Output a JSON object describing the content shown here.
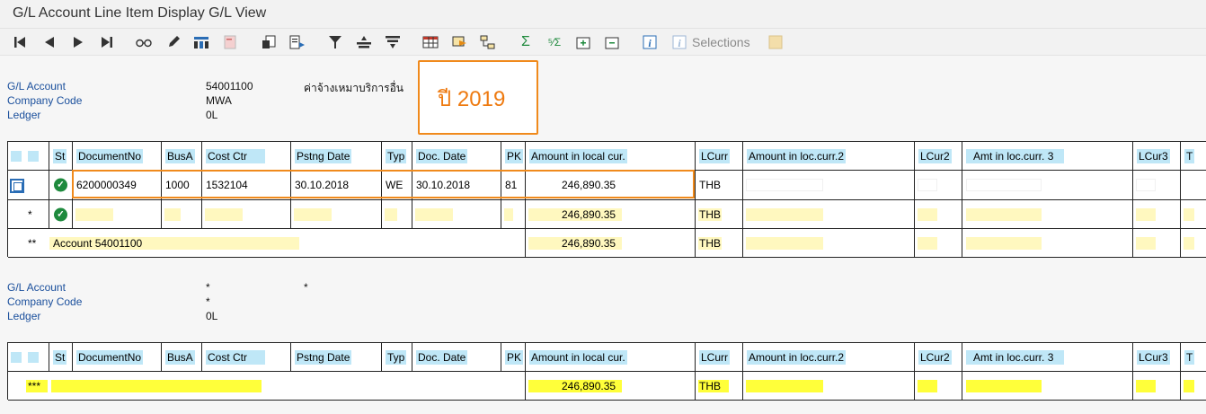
{
  "window": {
    "title": "G/L Account Line Item Display G/L View"
  },
  "toolbar": {
    "icons": [
      "first-page-icon",
      "previous-page-icon",
      "next-page-icon",
      "last-page-icon",
      "glasses-icon",
      "pencil-icon",
      "layout-icon",
      "document-icon",
      "print-list-icon",
      "export-icon",
      "filter-icon",
      "sort-ascending-icon",
      "sort-descending-icon",
      "table-icon",
      "export-spreadsheet-icon",
      "hierarchy-icon",
      "sum-icon",
      "subtotal-icon",
      "expand-icon",
      "collapse-icon",
      "info-icon",
      "info-disabled-icon",
      "note-icon"
    ],
    "selections_label": "Selections"
  },
  "header1": {
    "labels": [
      "G/L Account",
      "Company Code",
      "Ledger"
    ],
    "values": [
      "54001100",
      "MWA",
      "0L"
    ],
    "account_desc": "ค่าจ้างเหมาบริการอื่น"
  },
  "callout": {
    "text": "ปี 2019"
  },
  "columns": [
    "St",
    "DocumentNo",
    "BusA",
    "Cost Ctr",
    "Pstng Date",
    "Typ",
    "Doc. Date",
    "PK",
    "Amount in local cur.",
    "LCurr",
    "Amount in loc.curr.2",
    "LCur2",
    "Amt in loc.curr. 3",
    "LCur3",
    "T"
  ],
  "table1": {
    "row1": {
      "document_no": "6200000349",
      "bus_area": "1000",
      "cost_ctr": "1532104",
      "pstng_date": "30.10.2018",
      "typ": "WE",
      "doc_date": "30.10.2018",
      "pk": "81",
      "amount": "246,890.35",
      "lcurr": "THB"
    },
    "row2": {
      "marker": "*",
      "amount": "246,890.35",
      "lcurr": "THB"
    },
    "row3": {
      "marker": "**",
      "label": "Account 54001100",
      "amount": "246,890.35",
      "lcurr": "THB"
    }
  },
  "header2": {
    "labels": [
      "G/L Account",
      "Company Code",
      "Ledger"
    ],
    "values": [
      "*",
      "*",
      "0L"
    ],
    "account_desc": "*"
  },
  "table2": {
    "total_row": {
      "marker": "***",
      "amount": "246,890.35",
      "lcurr": "THB"
    }
  },
  "colors": {
    "orange_highlight": "#f08a1c",
    "header_cyan": "#bfe7f7",
    "subtotal_yellow": "#fff8bf",
    "total_yellow": "#ffff3a",
    "label_blue": "#1a4f9c"
  }
}
